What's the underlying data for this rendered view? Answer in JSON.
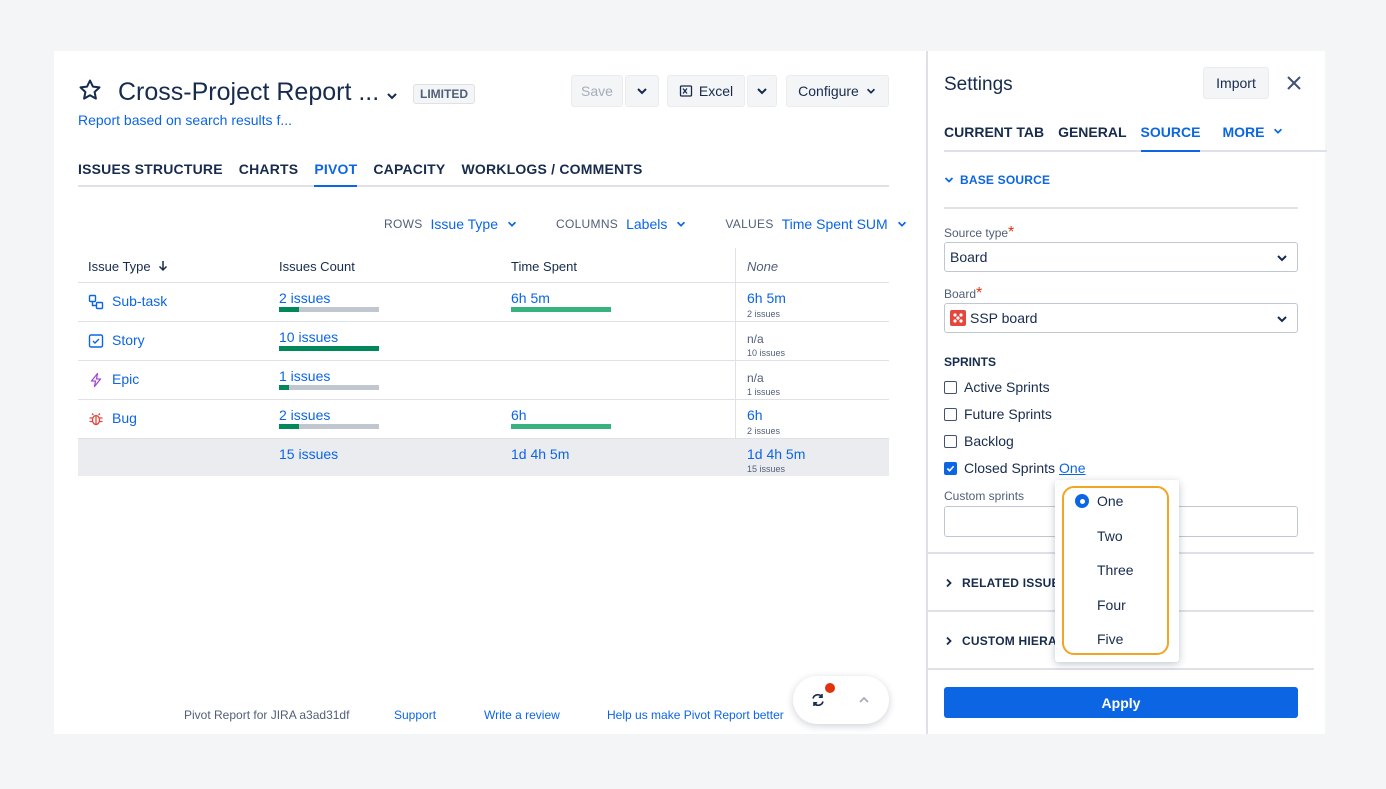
{
  "header": {
    "title": "Cross-Project Report ...",
    "badge": "LIMITED",
    "subtitle": "Report based on search results f...",
    "save_label": "Save",
    "excel_label": "Excel",
    "configure_label": "Configure"
  },
  "tabs": [
    {
      "label": "ISSUES STRUCTURE"
    },
    {
      "label": "CHARTS"
    },
    {
      "label": "PIVOT"
    },
    {
      "label": "CAPACITY"
    },
    {
      "label": "WORKLOGS / COMMENTS"
    }
  ],
  "pivot": {
    "rows_label": "ROWS",
    "rows_value": "Issue Type",
    "columns_label": "COLUMNS",
    "columns_value": "Labels",
    "values_label": "VALUES",
    "values_value": "Time Spent SUM"
  },
  "table": {
    "headers": [
      "Issue Type",
      "Issues Count",
      "Time Spent",
      "None"
    ],
    "rows": [
      {
        "type": "Sub-task",
        "icon": "subtask-icon",
        "count": "2 issues",
        "count_fill": 0.2,
        "time": "6h 5m",
        "time_fill": 1.0,
        "none": "6h 5m",
        "none_sub": "2 issues"
      },
      {
        "type": "Story",
        "icon": "story-icon",
        "count": "10 issues",
        "count_fill": 1.0,
        "time": "",
        "time_fill": 0,
        "none": "n/a",
        "none_sub": "10 issues"
      },
      {
        "type": "Epic",
        "icon": "epic-icon",
        "count": "1 issues",
        "count_fill": 0.1,
        "time": "",
        "time_fill": 0,
        "none": "n/a",
        "none_sub": "1 issues"
      },
      {
        "type": "Bug",
        "icon": "bug-icon",
        "count": "2 issues",
        "count_fill": 0.2,
        "time": "6h",
        "time_fill": 1.0,
        "none": "6h",
        "none_sub": "2 issues"
      }
    ],
    "total": {
      "count": "15 issues",
      "time": "1d 4h 5m",
      "none": "1d 4h 5m",
      "none_sub": "15 issues"
    }
  },
  "footer": {
    "version": "Pivot Report for JIRA a3ad31df",
    "support": "Support",
    "review": "Write a review",
    "help": "Help us make Pivot Report better"
  },
  "settings": {
    "title": "Settings",
    "import_label": "Import",
    "tabs": [
      "CURRENT TAB",
      "GENERAL",
      "SOURCE",
      "MORE"
    ],
    "base_source": "BASE SOURCE",
    "source_type_label": "Source type",
    "source_type_value": "Board",
    "board_label": "Board",
    "board_value": "SSP board",
    "sprints_heading": "SPRINTS",
    "sprints": [
      {
        "label": "Active Sprints",
        "checked": false
      },
      {
        "label": "Future Sprints",
        "checked": false
      },
      {
        "label": "Backlog",
        "checked": false
      },
      {
        "label": "Closed Sprints",
        "checked": true,
        "link": "One"
      }
    ],
    "custom_sprints_label": "Custom sprints",
    "related_issues": "RELATED ISSUES",
    "custom_hierarchy": "CUSTOM HIERA",
    "apply_label": "Apply"
  },
  "dropdown": {
    "options": [
      "One",
      "Two",
      "Three",
      "Four",
      "Five"
    ],
    "selected": "One"
  },
  "colors": {
    "accent": "#0c66e4",
    "bar_green": "#00875a",
    "bar_light_green": "#36b37e",
    "highlight": "#f2a524"
  }
}
